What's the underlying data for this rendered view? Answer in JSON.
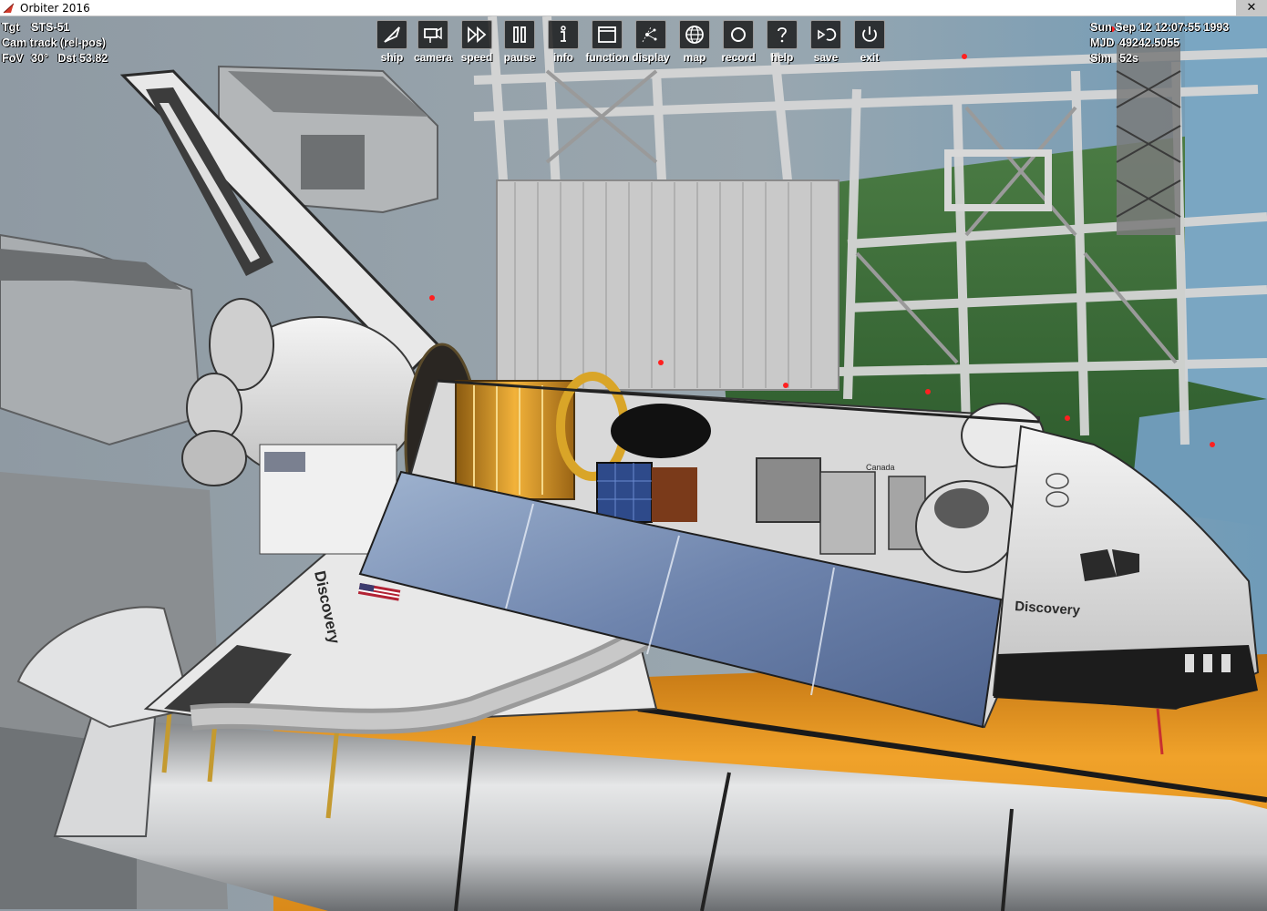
{
  "window": {
    "title": "Orbiter 2016",
    "close_glyph": "✕"
  },
  "hud_left": [
    {
      "key": "Tgt",
      "value": "STS-51"
    },
    {
      "key": "Cam track (rel-pos)",
      "value": ""
    },
    {
      "key": "FoV",
      "value": "30°   Dst 53.82"
    }
  ],
  "hud_right": [
    {
      "key": "Sun Sep 12 12:07:55 1993",
      "value": ""
    },
    {
      "key": "MJD",
      "value": "49242.5055"
    },
    {
      "key": "Sim",
      "value": "52s"
    }
  ],
  "toolbar": [
    {
      "id": "ship",
      "label": "ship",
      "icon": "ship-icon"
    },
    {
      "id": "camera",
      "label": "camera",
      "icon": "camera-icon"
    },
    {
      "id": "speed",
      "label": "speed",
      "icon": "fast-forward-icon"
    },
    {
      "id": "pause",
      "label": "pause",
      "icon": "pause-icon"
    },
    {
      "id": "info",
      "label": "info",
      "icon": "info-icon"
    },
    {
      "id": "function",
      "label": "function",
      "icon": "window-icon"
    },
    {
      "id": "display",
      "label": "display",
      "icon": "display-icon"
    },
    {
      "id": "map",
      "label": "map",
      "icon": "globe-icon"
    },
    {
      "id": "record",
      "label": "record",
      "icon": "record-icon"
    },
    {
      "id": "help",
      "label": "help",
      "icon": "help-icon"
    },
    {
      "id": "save",
      "label": "save",
      "icon": "save-icon"
    },
    {
      "id": "exit",
      "label": "exit",
      "icon": "power-icon"
    }
  ],
  "scene": {
    "orbiter_name_label": "Discovery",
    "bay_label": "Canada",
    "colors": {
      "external_tank": "#e8961e",
      "structure": "#b0b0b0",
      "sky": "#6f9bb8",
      "grass": "#3f6e3a"
    }
  }
}
